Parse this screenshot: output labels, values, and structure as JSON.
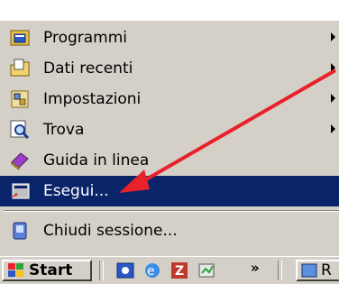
{
  "menu": {
    "items": [
      {
        "label": "Programmi",
        "icon": "programs-folder-icon",
        "submenu": true
      },
      {
        "label": "Dati recenti",
        "icon": "documents-folder-icon",
        "submenu": true
      },
      {
        "label": "Impostazioni",
        "icon": "settings-icon",
        "submenu": true
      },
      {
        "label": "Trova",
        "icon": "find-icon",
        "submenu": true
      },
      {
        "label": "Guida in linea",
        "icon": "help-book-icon",
        "submenu": false
      },
      {
        "label": "Esegui...",
        "icon": "run-icon",
        "submenu": false,
        "selected": true
      }
    ],
    "logoff": {
      "label": "Chiudi sessione...",
      "icon": "logoff-icon"
    }
  },
  "taskbar": {
    "start_label": "Start",
    "overflow": "»",
    "task_label": "R"
  },
  "colors": {
    "menu_bg": "#d4d0c8",
    "selected_bg": "#0a246a",
    "arrow_annotation": "#e8212b"
  }
}
